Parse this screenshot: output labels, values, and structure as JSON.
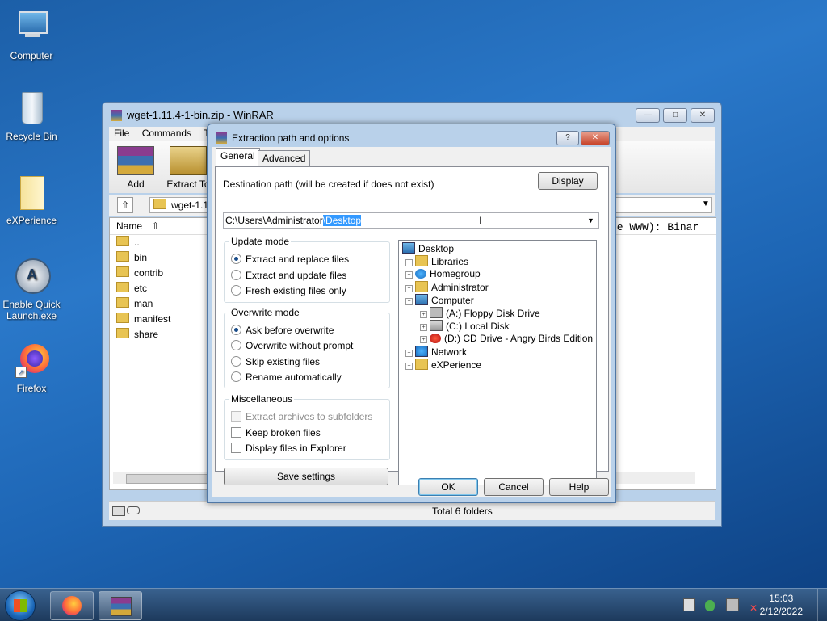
{
  "desktop": {
    "icons": [
      {
        "label": "Computer"
      },
      {
        "label": "Recycle Bin"
      },
      {
        "label": "eXPerience"
      },
      {
        "label": "Enable Quick Launch.exe"
      },
      {
        "label": "Firefox"
      }
    ]
  },
  "winrar": {
    "title": "wget-1.11.4-1-bin.zip - WinRAR",
    "menu": [
      "File",
      "Commands",
      "T"
    ],
    "toolbar": [
      "Add",
      "Extract To"
    ],
    "address": "wget-1.1",
    "list_header": "Name",
    "files": [
      "..",
      "bin",
      "contrib",
      "etc",
      "man",
      "manifest",
      "share"
    ],
    "right_text": "ne WWW): Binar",
    "status": "Total 6 folders"
  },
  "dialog": {
    "title": "Extraction path and options",
    "tabs": [
      "General",
      "Advanced"
    ],
    "dest_label": "Destination path (will be created if does not exist)",
    "display_button": "Display",
    "path_prefix": "C:\\Users\\Administrator",
    "path_selected": "\\Desktop",
    "update_mode": {
      "label": "Update mode",
      "options": [
        "Extract and replace files",
        "Extract and update files",
        "Fresh existing files only"
      ]
    },
    "overwrite_mode": {
      "label": "Overwrite mode",
      "options": [
        "Ask before overwrite",
        "Overwrite without prompt",
        "Skip existing files",
        "Rename automatically"
      ]
    },
    "misc": {
      "label": "Miscellaneous",
      "options": [
        "Extract archives to subfolders",
        "Keep broken files",
        "Display files in Explorer"
      ]
    },
    "save_settings": "Save settings",
    "tree": [
      "Desktop",
      "Libraries",
      "Homegroup",
      "Administrator",
      "Computer",
      "(A:) Floppy Disk Drive",
      "(C:) Local Disk",
      "(D:) CD Drive - Angry Birds Edition",
      "Network",
      "eXPerience"
    ],
    "ok": "OK",
    "cancel": "Cancel",
    "help": "Help"
  },
  "taskbar": {
    "time": "15:03",
    "date": "2/12/2022"
  }
}
